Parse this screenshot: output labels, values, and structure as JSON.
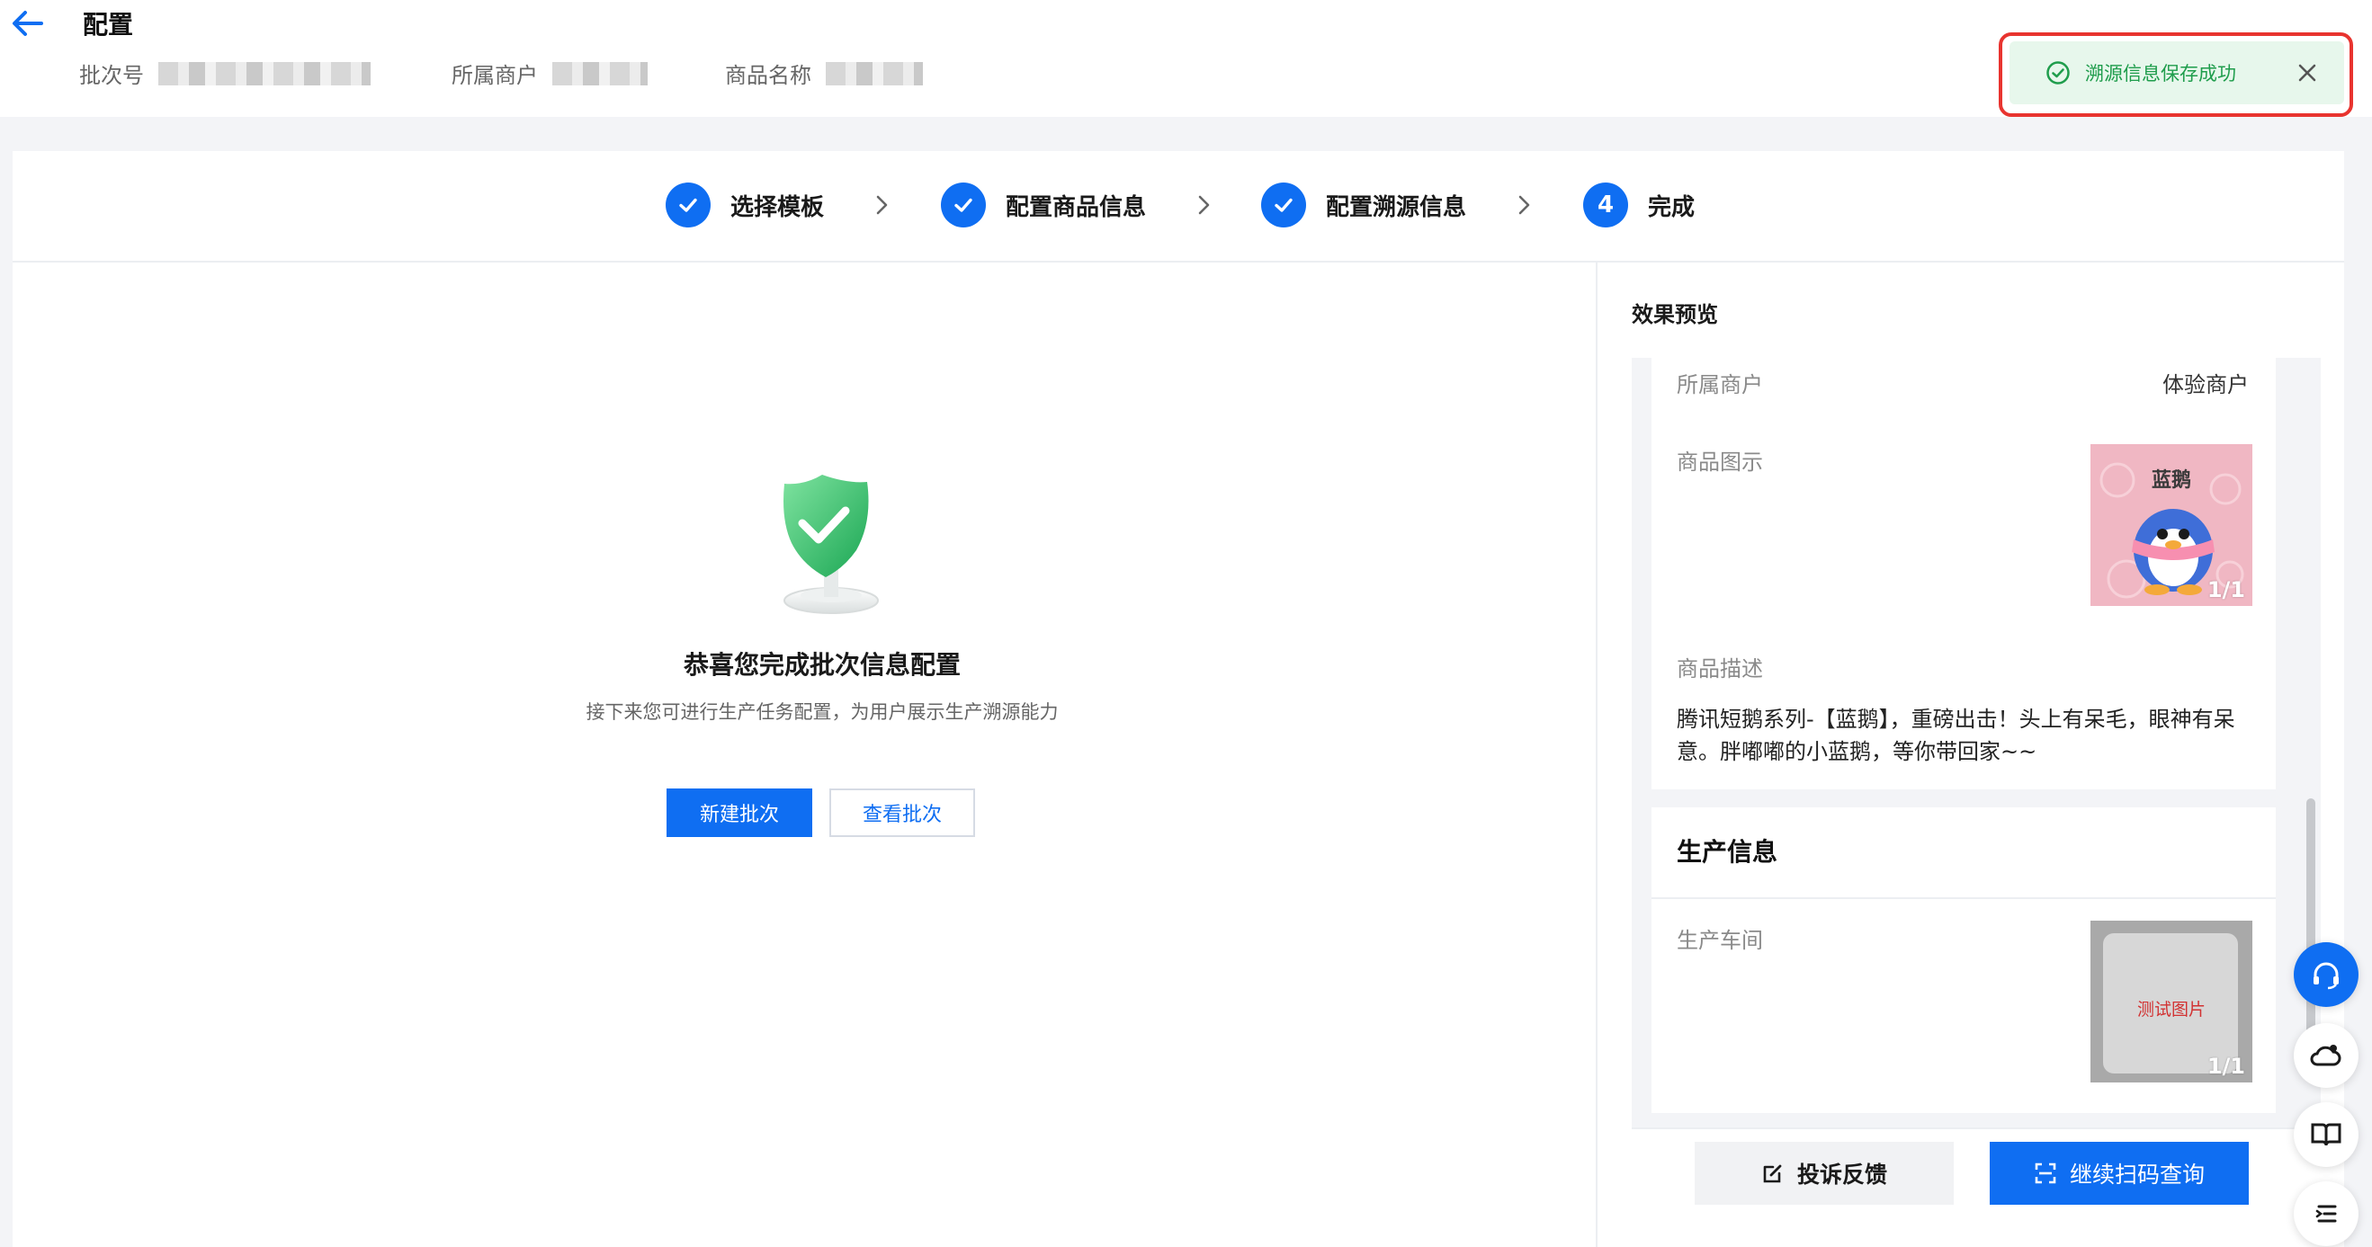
{
  "header": {
    "title": "配置",
    "meta": [
      {
        "label": "批次号"
      },
      {
        "label": "所属商户"
      },
      {
        "label": "商品名称"
      }
    ]
  },
  "toast": {
    "message": "溯源信息保存成功"
  },
  "steps": [
    {
      "label": "选择模板",
      "status": "done"
    },
    {
      "label": "配置商品信息",
      "status": "done"
    },
    {
      "label": "配置溯源信息",
      "status": "done"
    },
    {
      "label": "完成",
      "number": "4",
      "status": "current"
    }
  ],
  "success": {
    "title": "恭喜您完成批次信息配置",
    "subtitle": "接下来您可进行生产任务配置，为用户展示生产溯源能力",
    "primary_button": "新建批次",
    "secondary_button": "查看批次"
  },
  "preview": {
    "title": "效果预览",
    "merchant_label": "所属商户",
    "merchant_value": "体验商户",
    "image_label": "商品图示",
    "image_counter": "1/1",
    "product_image_text": "蓝鹅",
    "desc_label": "商品描述",
    "desc_value": "腾讯短鹅系列-【蓝鹅】，重磅出击！头上有呆毛，眼神有呆意。胖嘟嘟的小蓝鹅，等你带回家~~",
    "production_title": "生产信息",
    "workshop_label": "生产车间",
    "workshop_image_text": "测试图片",
    "workshop_image_counter": "1/1",
    "complaint_button": "投诉反馈",
    "scan_button": "继续扫码查询"
  },
  "colors": {
    "primary": "#0f6ef2",
    "success": "#1f9d4c",
    "toast_bg": "#e7f7ec",
    "highlight": "#e8342f"
  },
  "icons": {
    "back": "arrow-left-icon",
    "toast": "check-circle-icon",
    "close": "close-icon",
    "separator": "chevron-right-icon",
    "success": "shield-check-icon",
    "complaint": "edit-icon",
    "scan": "scan-icon",
    "float": [
      "headset-icon",
      "cloud-user-icon",
      "book-icon",
      "list-icon"
    ]
  }
}
